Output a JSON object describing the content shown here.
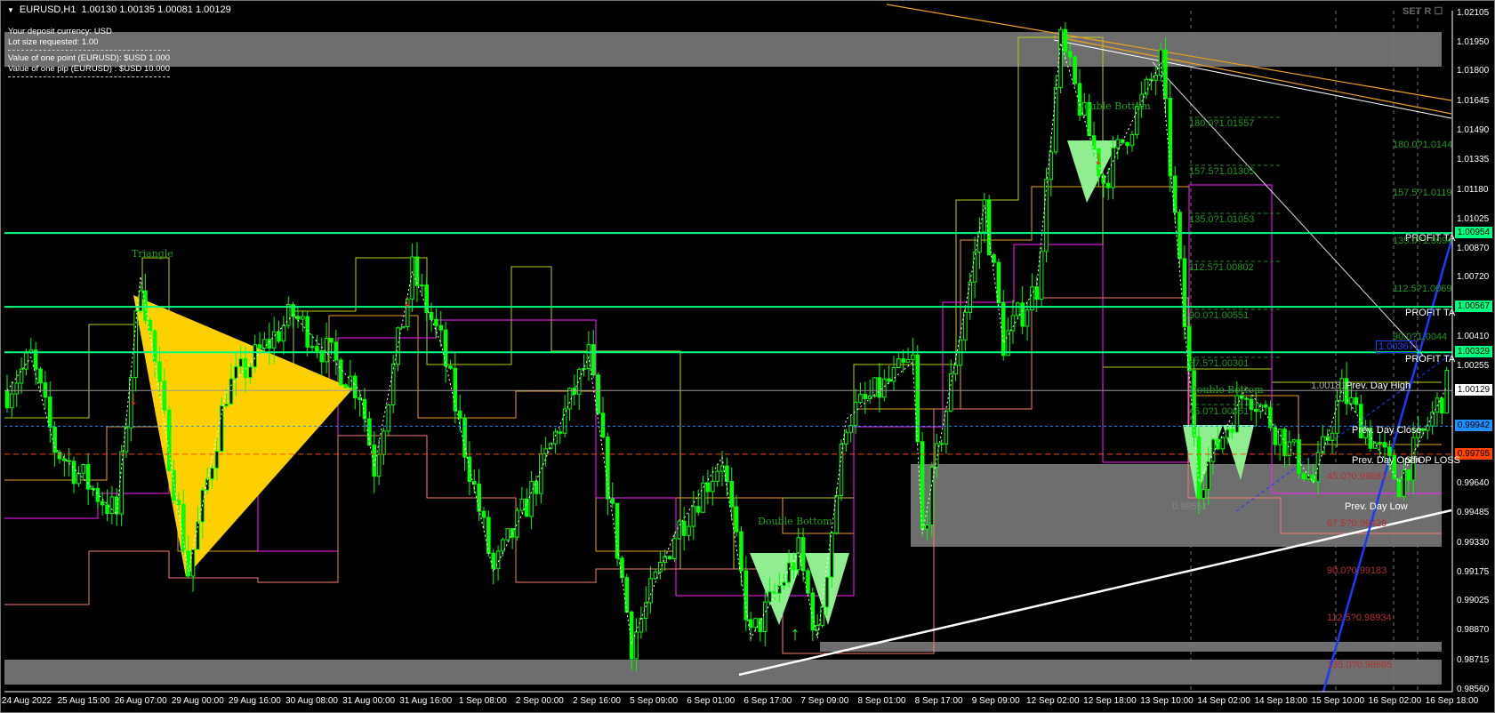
{
  "window": {
    "symbol": "EURUSD,H1",
    "ohlc": "1.00130 1.00135 1.00081 1.00129",
    "set_label": "SET R ☐"
  },
  "info_panel": {
    "deposit": "Your deposit currency: USD",
    "lot": "Lot size requested: 1.00",
    "point_value": "Value of one point (EURUSD):  $USD 1.000",
    "pip_value": "Value of one pip    (EURUSD) : $USD 10.000"
  },
  "price_axis": {
    "ticks": [
      "1.02105",
      "1.01950",
      "1.01800",
      "1.01645",
      "1.01490",
      "1.01335",
      "1.01180",
      "1.01025",
      "1.00870",
      "1.00720",
      "1.00410",
      "1.00255",
      "0.99640",
      "0.99485",
      "0.99330",
      "0.99175",
      "0.99025",
      "0.98870",
      "0.98715",
      "0.98560"
    ],
    "tick_values": [
      1.02105,
      1.0195,
      1.018,
      1.01645,
      1.0149,
      1.01335,
      1.0118,
      1.01025,
      1.0087,
      1.0072,
      1.0041,
      1.00255,
      0.9964,
      0.99485,
      0.9933,
      0.99175,
      0.99025,
      0.9887,
      0.98715,
      0.9856
    ],
    "markers": [
      {
        "label": "1.00954",
        "value": 1.00954,
        "bg": "#00ff7f",
        "fg": "#000000"
      },
      {
        "label": "1.00567",
        "value": 1.00567,
        "bg": "#00ff7f",
        "fg": "#000000"
      },
      {
        "label": "1.00329",
        "value": 1.00329,
        "bg": "#00ff7f",
        "fg": "#000000"
      },
      {
        "label": "1.00129",
        "value": 1.00129,
        "bg": "#ffffff",
        "fg": "#000000"
      },
      {
        "label": "0.99942",
        "value": 0.99942,
        "bg": "#1e90ff",
        "fg": "#000000"
      },
      {
        "label": "0.99795",
        "value": 0.99795,
        "bg": "#ff4500",
        "fg": "#000000"
      }
    ]
  },
  "time_axis": [
    "24 Aug 2022",
    "25 Aug 15:00",
    "26 Aug 07:00",
    "29 Aug 00:00",
    "29 Aug 16:00",
    "30 Aug 08:00",
    "31 Aug 00:00",
    "31 Aug 16:00",
    "1 Sep 08:00",
    "2 Sep 00:00",
    "2 Sep 16:00",
    "5 Sep 09:00",
    "6 Sep 01:00",
    "6 Sep 17:00",
    "7 Sep 09:00",
    "8 Sep 01:00",
    "8 Sep 17:00",
    "9 Sep 09:00",
    "12 Sep 02:00",
    "12 Sep 18:00",
    "13 Sep 10:00",
    "14 Sep 02:00",
    "14 Sep 18:00",
    "15 Sep 10:00",
    "16 Sep 02:00",
    "16 Sep 18:00"
  ],
  "annotations": {
    "triangle": "Triangle",
    "double_bottom_1": "Double Bottom",
    "double_bottom_2": "Double Bottom",
    "double_bottom_3": "Double Bottom",
    "profit_target_1": "PROFIT TA",
    "profit_target_2": "PROFIT TA",
    "profit_target_3": "PROFIT TA",
    "prev_day_high": "Prev. Day High",
    "prev_day_close": "Prev. Day Close",
    "prev_day_open": "Prev. Day Open",
    "prev_day_low": "Prev. Day Low",
    "stop_loss": "STOP LOSS",
    "level_1": "1.00181",
    "level_2": "1.00367",
    "level_3": "0.99551",
    "fib_left": [
      "180.0?1.01557",
      "157.5?1.01305",
      "135.0?1.01053",
      "112.5?1.00802",
      "90.0?1.00551",
      "67.5?1.00301",
      "45.0?1.00051"
    ],
    "fib_right": [
      "180.0?1.0144",
      "157.5?1.0119",
      "135.0?1.0094",
      "112.5?1.0069",
      "90.0?1.0044"
    ],
    "fib_red": [
      "45.0?0.99681",
      "67.5?0.99429",
      "90.0?0.99183",
      "112.5?0.98934",
      "135.0?0.98685"
    ]
  },
  "chart_data": {
    "type": "candlestick",
    "symbol": "EURUSD",
    "timeframe": "H1",
    "ylim": [
      0.9856,
      1.02105
    ],
    "price_path_waypoints": [
      [
        0,
        1.00128
      ],
      [
        5,
        1.00303
      ],
      [
        10,
        0.99828
      ],
      [
        23,
        0.99479
      ],
      [
        28,
        1.00727
      ],
      [
        38,
        0.99179
      ],
      [
        46,
        1.00128
      ],
      [
        60,
        1.00527
      ],
      [
        74,
        1.00128
      ],
      [
        77,
        0.99728
      ],
      [
        85,
        1.00752
      ],
      [
        91,
        1.00377
      ],
      [
        102,
        0.99179
      ],
      [
        108,
        0.99479
      ],
      [
        122,
        1.00303
      ],
      [
        131,
        0.98805
      ],
      [
        140,
        0.99379
      ],
      [
        150,
        0.99778
      ],
      [
        156,
        0.9883
      ],
      [
        166,
        0.99279
      ],
      [
        170,
        0.9883
      ],
      [
        176,
        0.99978
      ],
      [
        190,
        1.00278
      ],
      [
        192,
        0.99379
      ],
      [
        200,
        1.00427
      ],
      [
        205,
        1.01101
      ],
      [
        209,
        1.00377
      ],
      [
        216,
        1.00677
      ],
      [
        221,
        1.0195
      ],
      [
        230,
        1.01226
      ],
      [
        242,
        1.0185
      ],
      [
        250,
        0.99648
      ],
      [
        260,
        1.00148
      ],
      [
        274,
        0.99648
      ],
      [
        280,
        1.00128
      ],
      [
        292,
        0.99648
      ],
      [
        302,
        1.00148
      ]
    ],
    "last_price": 1.00129
  }
}
